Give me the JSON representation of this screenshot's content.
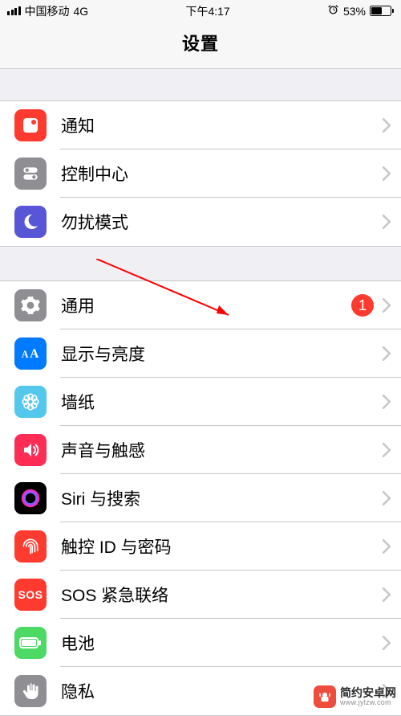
{
  "status": {
    "carrier": "中国移动",
    "network": "4G",
    "time": "下午4:17",
    "battery_pct": "53%"
  },
  "header": {
    "title": "设置"
  },
  "group1": [
    {
      "label": "通知"
    },
    {
      "label": "控制中心"
    },
    {
      "label": "勿扰模式"
    }
  ],
  "group2": [
    {
      "label": "通用",
      "badge": "1"
    },
    {
      "label": "显示与亮度"
    },
    {
      "label": "墙纸"
    },
    {
      "label": "声音与触感"
    },
    {
      "label": "Siri 与搜索"
    },
    {
      "label": "触控 ID 与密码"
    },
    {
      "label": "SOS 紧急联络",
      "icon_text": "SOS"
    },
    {
      "label": "电池"
    },
    {
      "label": "隐私"
    }
  ],
  "watermark": {
    "brand": "简约安卓网",
    "url": "www.jylzw.com"
  }
}
